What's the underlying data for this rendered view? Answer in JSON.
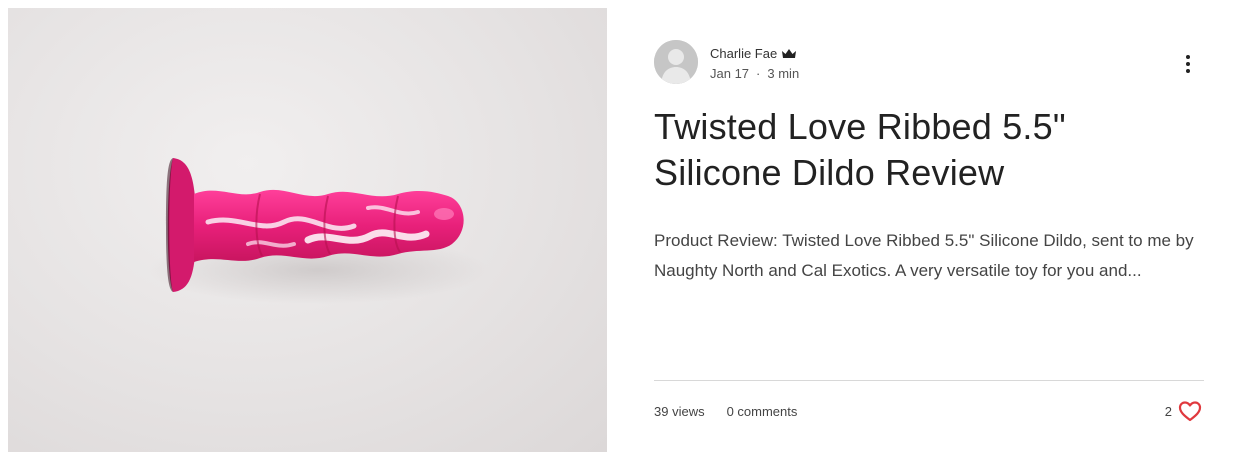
{
  "post": {
    "author": "Charlie Fae",
    "date": "Jan 17",
    "separator": "·",
    "read_time": "3 min",
    "title": "Twisted Love Ribbed 5.5\" Silicone Dildo Review",
    "excerpt": "Product Review: Twisted Love Ribbed 5.5\" Silicone Dildo, sent to me by Naughty North and Cal Exotics. A very versatile toy for you and...",
    "views": "39 views",
    "comments": "0 comments",
    "likes": "2"
  },
  "icons": {
    "avatar": "user-silhouette-icon",
    "badge": "crown-icon",
    "menu": "more-vertical-icon",
    "like": "heart-icon"
  },
  "colors": {
    "heart": "#e0393e",
    "toy_pink": "#e8207a",
    "text": "#222222"
  }
}
